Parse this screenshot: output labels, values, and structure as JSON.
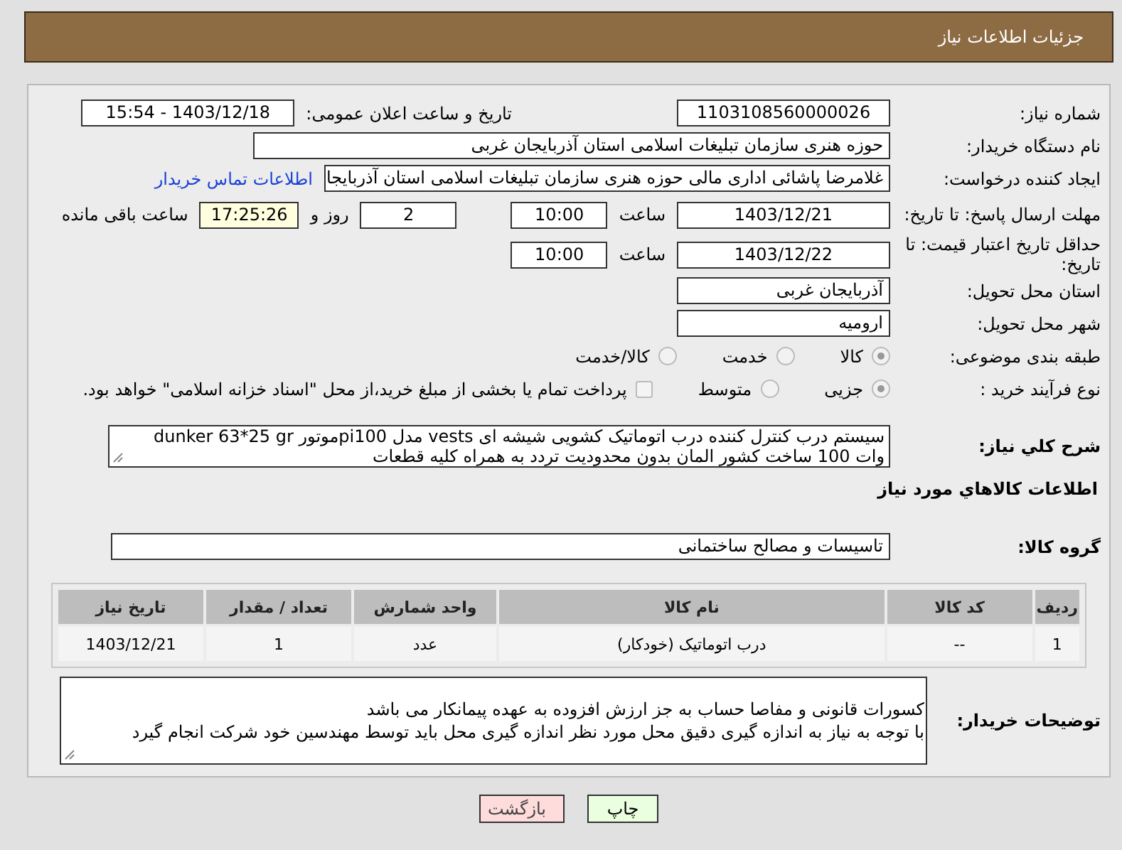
{
  "header": {
    "title": "جزئیات اطلاعات نیاز"
  },
  "fields": {
    "need_number": {
      "label": "شماره نیاز:",
      "value": "1103108560000026"
    },
    "announce": {
      "label": "تاریخ و ساعت اعلان عمومی:",
      "value": "1403/12/18 - 15:54"
    },
    "buyer": {
      "label": "نام دستگاه خریدار:",
      "value": "حوزه هنری سازمان تبلیغات اسلامی استان آذربایجان غربی"
    },
    "creator": {
      "label": "ایجاد کننده درخواست:",
      "value": "غلامرضا پاشائی اداری مالی حوزه هنری سازمان تبلیغات اسلامی استان آذربایجا",
      "link": "اطلاعات تماس خریدار"
    },
    "deadline": {
      "label": "مهلت ارسال پاسخ: تا تاریخ:",
      "date": "1403/12/21",
      "time_label": "ساعت",
      "time": "10:00",
      "days": "2",
      "days_label": "روز و",
      "remaining": "17:25:26",
      "remaining_label": "ساعت باقی مانده"
    },
    "validity": {
      "label": "حداقل تاریخ اعتبار قیمت: تا تاریخ:",
      "date": "1403/12/22",
      "time_label": "ساعت",
      "time": "10:00"
    },
    "province": {
      "label": "استان محل تحویل:",
      "value": "آذربایجان غربی"
    },
    "city": {
      "label": "شهر محل تحویل:",
      "value": "ارومیه"
    }
  },
  "category": {
    "label": "طبقه بندی موضوعی:",
    "options": [
      {
        "label": "کالا",
        "selected": true
      },
      {
        "label": "خدمت",
        "selected": false
      },
      {
        "label": "کالا/خدمت",
        "selected": false
      }
    ]
  },
  "process": {
    "label": "نوع فرآیند خرید :",
    "options": [
      {
        "label": "جزیی",
        "selected": true
      },
      {
        "label": "متوسط",
        "selected": false
      }
    ],
    "treasury": {
      "label": "پرداخت تمام یا بخشی از مبلغ خرید،از محل \"اسناد خزانه اسلامی\" خواهد بود.",
      "checked": false
    }
  },
  "description": {
    "label": "شرح کلي نیاز:",
    "value": "سیستم درب کنترل کننده درب اتوماتیک کشویی شیشه ای vests مدل pi100موتور dunker 63*25 gr     وات 100 ساخت کشور المان بدون محدودیت تردد به همراه کلیه قطعات"
  },
  "goods_heading": "اطلاعات کالاهاي مورد نیاز",
  "goods_group": {
    "label": "گروه کالا:",
    "value": "تاسیسات و مصالح ساختمانی"
  },
  "table": {
    "columns": [
      "ردیف",
      "کد کالا",
      "نام کالا",
      "واحد شمارش",
      "تعداد / مقدار",
      "تاریخ نیاز"
    ],
    "rows": [
      [
        "1",
        "--",
        "درب اتوماتیک (خودکار)",
        "عدد",
        "1",
        "1403/12/21"
      ]
    ]
  },
  "buyer_notes": {
    "label": "توضیحات خریدار:",
    "lines": [
      "کسورات قانونی و مفاصا حساب به جز ارزش افزوده به عهده پیمانکار می باشد",
      "با توجه به نیاز به اندازه گیری دقیق محل مورد نظر اندازه گیری محل باید توسط مهندسین خود شرکت انجام گیرد"
    ]
  },
  "buttons": [
    {
      "label": "چاپ",
      "kind": "print"
    },
    {
      "label": "بازگشت",
      "kind": "back"
    }
  ]
}
